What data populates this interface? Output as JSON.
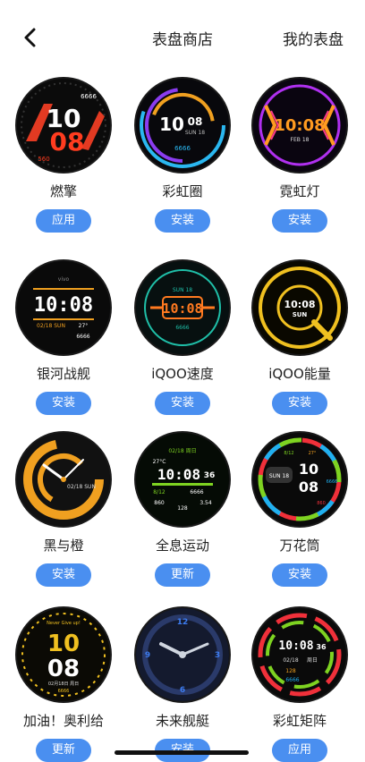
{
  "header": {
    "tab_store": "表盘商店",
    "tab_mine": "我的表盘"
  },
  "faces": [
    {
      "name": "燃擎",
      "button": "应用",
      "time_top": "10",
      "time_bottom": "08",
      "extra": "6666",
      "extra2": "560"
    },
    {
      "name": "彩虹圈",
      "button": "安装",
      "time_top": "10",
      "time_right": "08",
      "extra": "SUN 18",
      "extra2": "6666"
    },
    {
      "name": "霓虹灯",
      "button": "安装",
      "time": "10:08",
      "extra": "FEB 18"
    },
    {
      "name": "银河战舰",
      "button": "安装",
      "time": "10:08",
      "extra": "02/18 SUN",
      "extra2": "27°",
      "extra3": "6666",
      "extra4": "vivo"
    },
    {
      "name": "iQOO速度",
      "button": "安装",
      "time": "10:08",
      "extra": "SUN 18",
      "extra2": "6666"
    },
    {
      "name": "iQOO能量",
      "button": "安装",
      "time": "10:08",
      "extra": "SUN"
    },
    {
      "name": "黑与橙",
      "button": "安装",
      "extra": "02/18 SUN"
    },
    {
      "name": "全息运动",
      "button": "更新",
      "time": "10:08",
      "seconds": "36",
      "extra": "02/18 周日",
      "extra2": "27°C",
      "extra3": "6666",
      "extra4": "3.54",
      "extra5": "8/12",
      "extra6": "860",
      "extra7": "128"
    },
    {
      "name": "万花筒",
      "button": "安装",
      "time_top": "10",
      "time_bottom": "08",
      "extra": "SUN 18",
      "extra2": "6666",
      "extra3": "8/12",
      "extra4": "27°",
      "extra5": "860"
    },
    {
      "name": "加油！奥利给",
      "button": "更新",
      "time_top": "10",
      "time_bottom": "08",
      "extra": "Never Give up!",
      "extra2": "02月18日 周日",
      "extra3": "6666"
    },
    {
      "name": "未来舰艇",
      "button": "安装",
      "extra": "12",
      "extra2": "3",
      "extra3": "6",
      "extra4": "9"
    },
    {
      "name": "彩虹矩阵",
      "button": "应用",
      "time": "10:08",
      "seconds": "36",
      "extra": "02/18",
      "extra2": "周日",
      "extra3": "128",
      "extra4": "6666"
    }
  ]
}
